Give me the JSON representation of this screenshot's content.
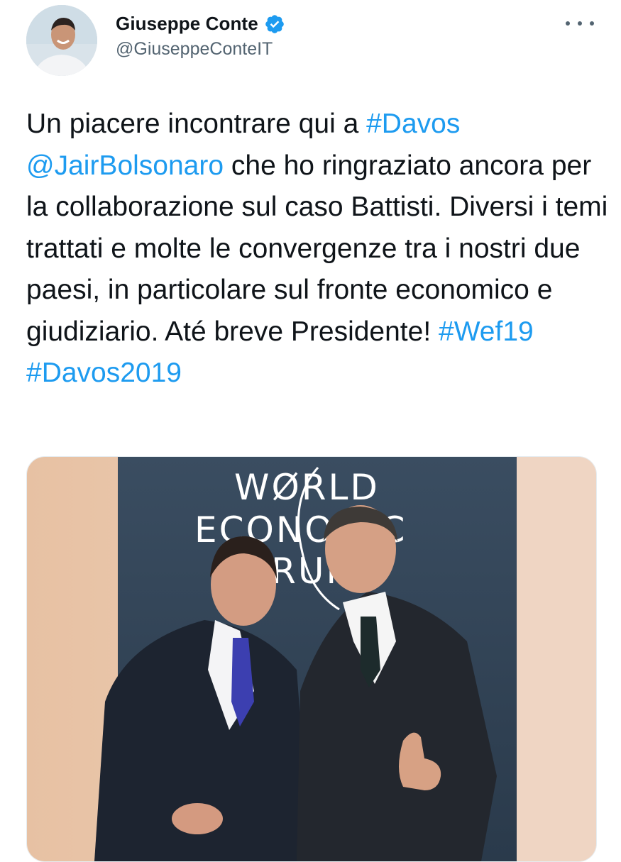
{
  "header": {
    "display_name": "Giuseppe Conte",
    "handle": "@GiuseppeConteIT",
    "verified_icon": "verified-badge-icon",
    "more_icon": "more-horizontal-icon"
  },
  "tweet": {
    "segments": [
      {
        "text": "Un piacere incontrare qui a ",
        "link": false
      },
      {
        "text": "#Davos",
        "link": true
      },
      {
        "text": " ",
        "link": false
      },
      {
        "text": "@JairBolsonaro",
        "link": true
      },
      {
        "text": " che ho ringraziato ancora per la collaborazione sul caso Battisti. Diversi i temi trattati e molte le convergenze tra i nostri due paesi, in particolare sul fronte economico e giudiziario. Até breve Presidente! ",
        "link": false
      },
      {
        "text": "#Wef19",
        "link": true
      },
      {
        "text": " ",
        "link": false
      },
      {
        "text": "#Davos2019",
        "link": true
      }
    ]
  },
  "media": {
    "backdrop_text": [
      "WØRLD",
      "ECONOMIC",
      "FORUM"
    ]
  },
  "colors": {
    "link": "#1d9bf0",
    "text": "#0f1419",
    "muted": "#536471",
    "backdrop": "#324559"
  }
}
